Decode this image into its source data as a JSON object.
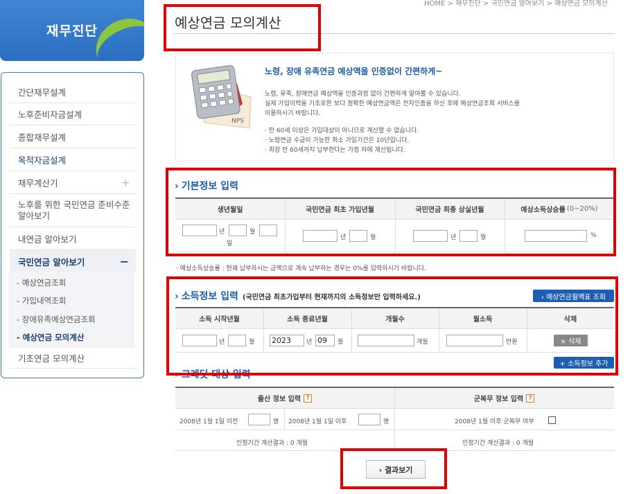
{
  "sidebar": {
    "title": "재무진단",
    "items": [
      {
        "label": "간단재무설계"
      },
      {
        "label": "노후준비자금설계"
      },
      {
        "label": "종합재무설계"
      },
      {
        "label": "목적자금설계"
      },
      {
        "label": "재무계산기",
        "expander": "+"
      },
      {
        "label": "노후를 위한 국민연금 준비수준 알아보기"
      },
      {
        "label": "내연금 알아보기"
      },
      {
        "label": "국민연금 알아보기",
        "expander": "−"
      },
      {
        "label": "기초연금 모의계산"
      }
    ],
    "subitems": [
      {
        "label": "- 예상연금조회"
      },
      {
        "label": "- 가입내역조회"
      },
      {
        "label": "- 장애유족예상연금조회"
      },
      {
        "label": "- 예상연금 모의계산"
      }
    ]
  },
  "breadcrumb": "HOME > 재무진단 > 국민연금 알아보기 > 예상연금 모의계산",
  "page_title": "예상연금 모의계산",
  "info": {
    "heading": "노령, 장애 유족연금 예상액을 인증없이 간편하게~",
    "lines": [
      "노령, 유족, 장애연금 예상액을 인증과정 없이 간편하게 알아볼 수 있습니다.",
      "실제 가입이력을 기초로한 보다 정확한 예상연금액은 전자인증을 하신 후에 예상연금조회 서비스를",
      "이용하시기 바랍니다.",
      "· 만 60세 이상은 가입대상이 아니므로 계산할 수 없습니다.",
      "· 노령연금 수급이 가능한 최소 가입기간은 10년입니다.",
      "· 최장 만 60세까지 납부한다는 가정 하에 계산됩니다."
    ],
    "image_label": "NPS"
  },
  "basic": {
    "title": "기본정보 입력",
    "headers": [
      "생년월일",
      "국민연금 최초 가입년월",
      "국민연금 최종 상실년월",
      "예상소득상승률"
    ],
    "rate_range": "(0~20%)",
    "unit_year": "년",
    "unit_month": "월",
    "unit_day": "일",
    "unit_percent": "%",
    "note": "· 예상소득상승률 : 현재 납부하시는 금액으로 계속 납부하는 경우는 0%를 입력하시기 바랍니다."
  },
  "income": {
    "title": "소득정보 입력",
    "subtitle": "(국민연금 최초가입부터 현재까지의 소득정보만 입력하세요.)",
    "lookup_button": "› 예상연금월액표 조회",
    "headers": [
      "소득 시작년월",
      "소득 종료년월",
      "개월수",
      "월소득",
      "삭제"
    ],
    "end_year": "2023",
    "end_month": "09",
    "unit_months": "개월",
    "unit_won": "만원",
    "delete_button": "× 삭제",
    "add_button": "+ 소득정보 추가"
  },
  "credit": {
    "title": "크레딧 대상 입력",
    "birth_header": "출산 정보 입력",
    "military_header": "군복무 정보 입력",
    "help": "?",
    "before_2008": "2008년 1월 1일 이전",
    "after_2008": "2008년 1월 1일 이후",
    "unit_person": "명",
    "military_label": "2008년 1월 이후 군복무 여부",
    "birth_result": "인정기간 계산결과 : 0 개월",
    "military_result": "인정기간 계산결과 : 0 개월"
  },
  "result_button": "› 결과보기",
  "colors": {
    "accent": "#1b5ca8",
    "highlight": "#e00000",
    "sidebar_border": "#3d78c2"
  }
}
